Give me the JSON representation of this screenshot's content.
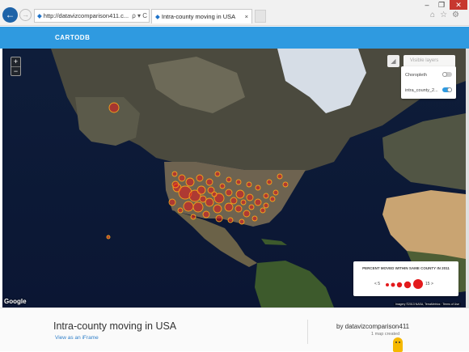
{
  "browser": {
    "address": "http://datavizcomparison411.c...",
    "address_tools": "ρ ▾ C",
    "tab_title": "Intra-county moving in USA",
    "tab_close": "×",
    "back_glyph": "←",
    "forward_glyph": "→",
    "window_controls": [
      "–",
      "❐",
      "✕"
    ],
    "toolbar_icons": [
      "home-icon",
      "star-icon",
      "gear-icon"
    ]
  },
  "app": {
    "logo": "CARTODB",
    "brand_color": "#2f9ae0"
  },
  "map_controls": {
    "zoom_in": "+",
    "zoom_out": "−",
    "visible_layers_placeholder": "Visible layers",
    "layers": [
      {
        "label": "Choropleth",
        "enabled": false
      },
      {
        "label": "intra_county_2...",
        "enabled": true
      }
    ]
  },
  "legend": {
    "title": "PERCENT MOVED WITHIN SAME COUNTY IN 2011",
    "low": "< 5",
    "high": "15 >",
    "bubble_color": "#e31a1c"
  },
  "map_attribution": {
    "google": "Google",
    "terms": "Imagery ©2013 NASA, TerraMetrics · Terms of Use"
  },
  "footer": {
    "title": "Intra-county moving in USA",
    "iframe_link": "View as an iFrame",
    "byline": "by datavizcomparison411",
    "maps_created": "1 map created"
  }
}
